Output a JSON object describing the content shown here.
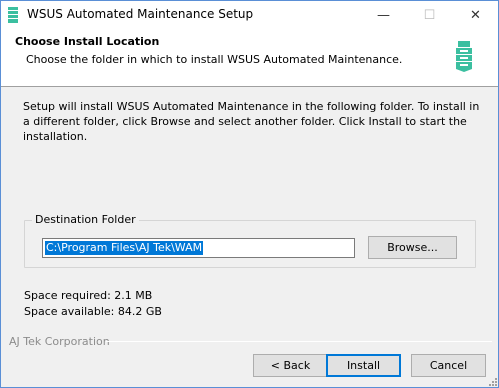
{
  "window": {
    "title": "WSUS Automated Maintenance Setup",
    "minimize_glyph": "—",
    "maximize_glyph": "☐",
    "close_glyph": "✕",
    "icon": "wam-logo-icon"
  },
  "header": {
    "title": "Choose Install Location",
    "subtitle": "Choose the folder in which to install WSUS Automated Maintenance.",
    "logo": "wam-logo-icon"
  },
  "body": {
    "description": "Setup will install WSUS Automated Maintenance in the following folder. To install in a different folder, click Browse and select another folder. Click Install to start the installation."
  },
  "destination": {
    "group_label": "Destination Folder",
    "path_value": "C:\\Program Files\\AJ Tek\\WAM",
    "browse_label": "Browse..."
  },
  "space": {
    "required": "Space required: 2.1 MB",
    "available": "Space available: 84.2 GB"
  },
  "footer": {
    "brand": "AJ Tek Corporation",
    "back_label": "< Back",
    "install_label": "Install",
    "cancel_label": "Cancel"
  },
  "colors": {
    "accent": "#0078d7",
    "logo_teal": "#3bbfa0",
    "window_border": "#5a8fd6",
    "dialog_background": "#f0f0f0"
  }
}
